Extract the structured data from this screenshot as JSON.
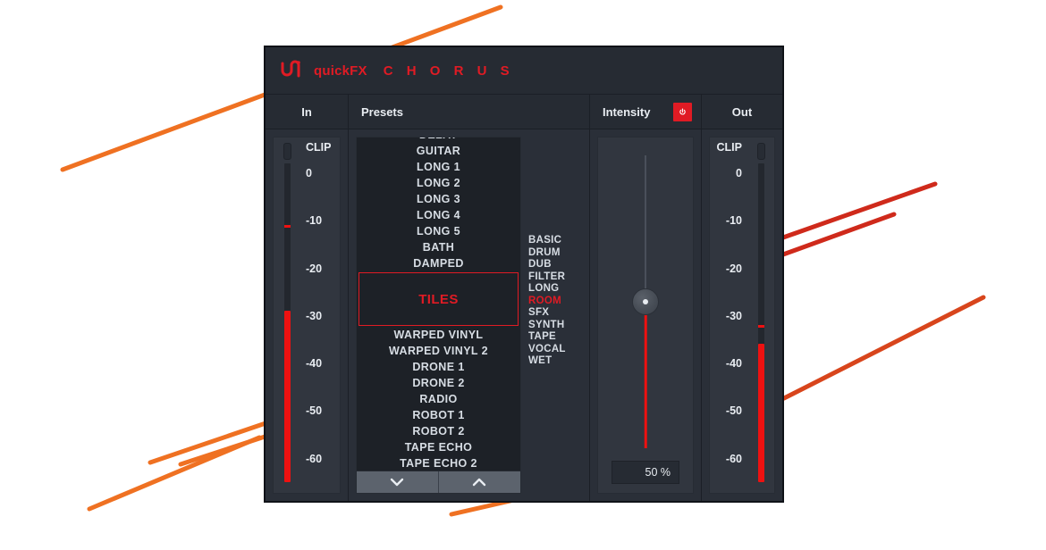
{
  "window": {
    "brand": "quickFX",
    "product": "C H O R U S",
    "logo_icon": "wave-logo-icon"
  },
  "colors": {
    "accent_red": "#e01b24",
    "meter_red": "#ee1111",
    "panel_bg": "#2a2f38",
    "header_bg": "#262b33",
    "list_bg": "#1d2127",
    "text": "#e9edf2",
    "deco_orange": "#ef7122",
    "deco_red": "#cf2a1b"
  },
  "in_meter": {
    "label": "In",
    "clip_label": "CLIP",
    "clip_active": false,
    "ticks": [
      "0",
      "-10",
      "-20",
      "-30",
      "-40",
      "-50",
      "-60"
    ],
    "level_db": -28,
    "peak_db": -10,
    "scale_min_db": -64,
    "scale_max_db": 3
  },
  "out_meter": {
    "label": "Out",
    "clip_label": "CLIP",
    "clip_active": false,
    "ticks": [
      "0",
      "-10",
      "-20",
      "-30",
      "-40",
      "-50",
      "-60"
    ],
    "level_db": -35,
    "peak_db": -31,
    "scale_min_db": -64,
    "scale_max_db": 3
  },
  "presets": {
    "label": "Presets",
    "selected": "TILES",
    "items_above": [
      "GUITAR",
      "LONG 1",
      "LONG 2",
      "LONG 3",
      "LONG 4",
      "LONG 5",
      "BATH",
      "DAMPED"
    ],
    "items_below": [
      "WARPED VINYL",
      "WARPED VINYL 2",
      "DRONE 1",
      "DRONE 2",
      "RADIO",
      "ROBOT 1",
      "ROBOT 2",
      "TAPE ECHO",
      "TAPE ECHO 2"
    ],
    "clipped_top_item": "DELAY",
    "nav_down_icon": "chevron-down-icon",
    "nav_up_icon": "chevron-up-icon",
    "categories": [
      "BASIC",
      "DRUM",
      "DUB",
      "FILTER",
      "LONG",
      "ROOM",
      "SFX",
      "SYNTH",
      "TAPE",
      "VOCAL",
      "WET"
    ],
    "active_category": "ROOM"
  },
  "intensity": {
    "label": "Intensity",
    "power_icon": "power-icon",
    "power_on": true,
    "value_text": "50 %",
    "value_percent": 50
  }
}
